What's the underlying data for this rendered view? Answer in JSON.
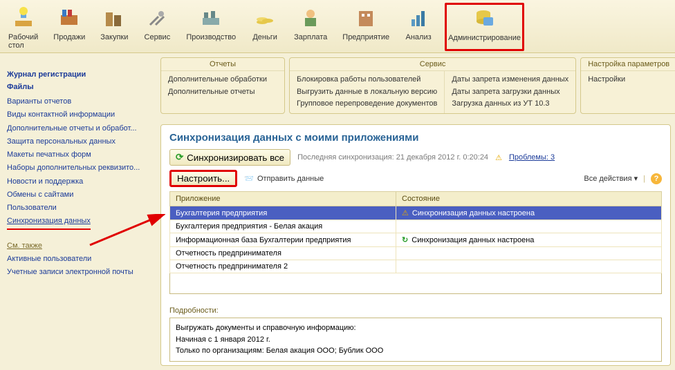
{
  "toolbar": [
    {
      "id": "desktop",
      "label": "Рабочий\nстол"
    },
    {
      "id": "sales",
      "label": "Продажи"
    },
    {
      "id": "purchases",
      "label": "Закупки"
    },
    {
      "id": "service",
      "label": "Сервис"
    },
    {
      "id": "production",
      "label": "Производство"
    },
    {
      "id": "money",
      "label": "Деньги"
    },
    {
      "id": "salary",
      "label": "Зарплата"
    },
    {
      "id": "enterprise",
      "label": "Предприятие"
    },
    {
      "id": "analysis",
      "label": "Анализ"
    },
    {
      "id": "admin",
      "label": "Администрирование",
      "highlight": true
    }
  ],
  "panels": {
    "reports": {
      "title": "Отчеты",
      "items": [
        "Дополнительные обработки",
        "Дополнительные отчеты"
      ]
    },
    "service": {
      "title": "Сервис",
      "cols": [
        [
          "Блокировка работы пользователей",
          "Выгрузить данные в локальную версию",
          "Групповое перепроведение документов"
        ],
        [
          "Даты запрета изменения данных",
          "Даты запрета загрузки данных",
          "Загрузка данных из УТ 10.3"
        ]
      ]
    },
    "params": {
      "title": "Настройка параметров",
      "items": [
        "Настройки"
      ]
    }
  },
  "sidebar": {
    "headers": [
      "Журнал регистрации",
      "Файлы"
    ],
    "links": [
      "Варианты отчетов",
      "Виды контактной информации",
      "Дополнительные отчеты и обработ...",
      "Защита персональных данных",
      "Макеты печатных форм",
      "Наборы дополнительных реквизито...",
      "Новости и поддержка",
      "Обмены с сайтами",
      "Пользователи",
      "Синхронизация данных"
    ],
    "see_also": "См. также",
    "see_links": [
      "Активные пользователи",
      "Учетные записи электронной почты"
    ]
  },
  "main": {
    "title": "Синхронизация данных с моими приложениями",
    "sync_all": "Синхронизировать все",
    "last_sync_label": "Последняя синхронизация:",
    "last_sync_value": "21 декабря 2012 г. 0:20:24",
    "problems_label": "Проблемы:",
    "problems_count": "3",
    "configure": "Настроить...",
    "send": "Отправить данные",
    "all_actions": "Все действия",
    "table": {
      "col_app": "Приложение",
      "col_state": "Состояние",
      "rows": [
        {
          "app": "Бухгалтерия предприятия",
          "state": "Синхронизация данных настроена",
          "icon": "warn",
          "selected": true
        },
        {
          "app": "Бухгалтерия предприятия - Белая акация",
          "state": "",
          "icon": ""
        },
        {
          "app": "Информационная база Бухгалтерии предприятия",
          "state": "Синхронизация данных настроена",
          "icon": "ok"
        },
        {
          "app": "Отчетность предпринимателя",
          "state": "",
          "icon": ""
        },
        {
          "app": "Отчетность предпринимателя 2",
          "state": "",
          "icon": ""
        }
      ]
    },
    "details_label": "Подробности:",
    "details_lines": [
      "Выгружать документы и справочную информацию:",
      "Начиная с 1 января 2012 г.",
      "Только по организациям: Белая акация ООО; Бублик ООО"
    ]
  }
}
